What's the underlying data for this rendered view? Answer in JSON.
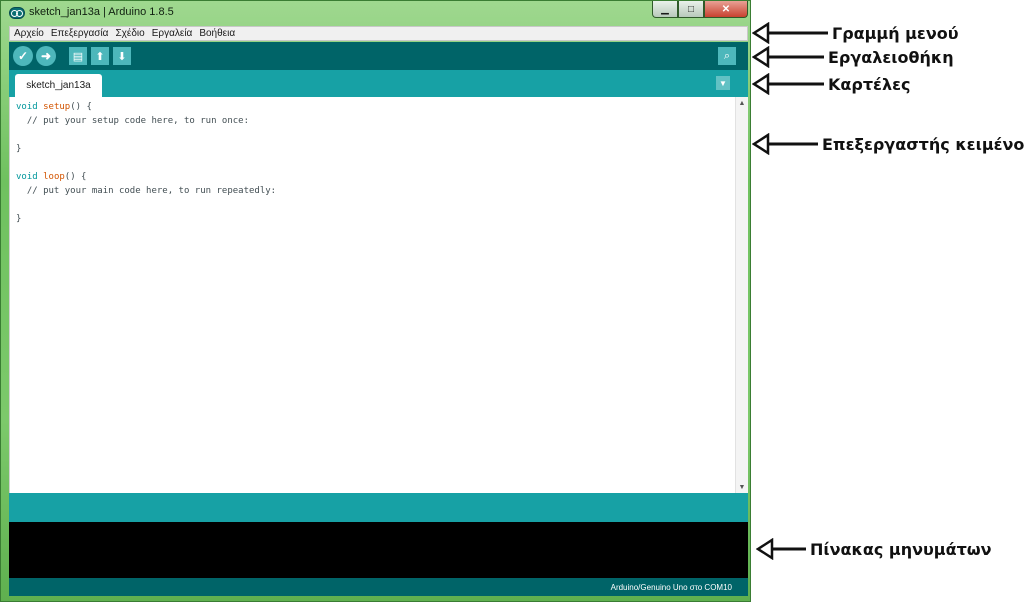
{
  "window": {
    "title": "sketch_jan13a | Arduino 1.8.5",
    "controls": {
      "minimize": "▁",
      "maximize": "□",
      "close": "✕"
    },
    "frame_color": "#7cc96b"
  },
  "menubar": {
    "items": [
      "Αρχείο",
      "Επεξεργασία",
      "Σχέδιο",
      "Εργαλεία",
      "Βοήθεια"
    ]
  },
  "toolbar": {
    "verify_glyph": "✓",
    "upload_glyph": "➜",
    "new_glyph": "▤",
    "open_glyph": "⬆",
    "save_glyph": "⬇",
    "serial_glyph": "⌕",
    "background": "#006468",
    "button_color": "#4db7bb"
  },
  "tabs": {
    "items": [
      "sketch_jan13a"
    ],
    "menu_glyph": "▼"
  },
  "editor": {
    "code_lines": [
      {
        "kw": "void",
        "fn": "setup",
        "rest": "() {"
      },
      {
        "text": "  // put your setup code here, to run once:"
      },
      {
        "text": ""
      },
      {
        "text": "}"
      },
      {
        "text": ""
      },
      {
        "kw": "void",
        "fn": "loop",
        "rest": "() {"
      },
      {
        "text": "  // put your main code here, to run repeatedly:"
      },
      {
        "text": ""
      },
      {
        "text": "}"
      }
    ],
    "scroll_up": "▲",
    "scroll_down": "▼"
  },
  "status": {
    "board_port": "Arduino/Genuino Uno στο COM10"
  },
  "annotations": {
    "menubar": "Γραμμή μενού",
    "toolbar": "Εργαλειοθήκη",
    "tabs": "Καρτέλες",
    "editor": "Επεξεργαστής κειμένου",
    "messages": "Πίνακας μηνυμάτων"
  }
}
